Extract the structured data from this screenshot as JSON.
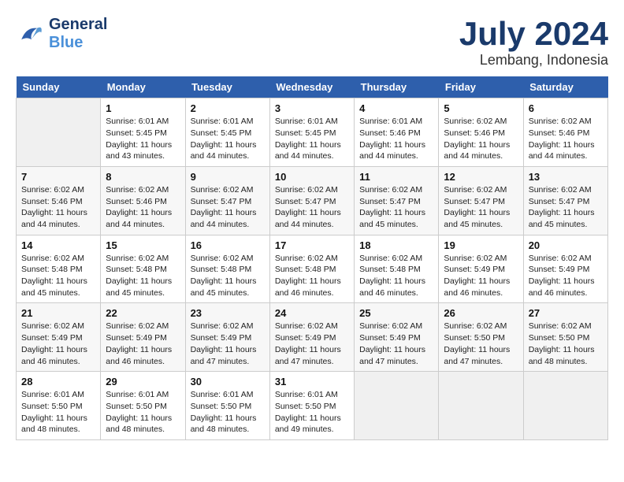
{
  "logo": {
    "line1": "General",
    "line2": "Blue"
  },
  "title": "July 2024",
  "location": "Lembang, Indonesia",
  "days_of_week": [
    "Sunday",
    "Monday",
    "Tuesday",
    "Wednesday",
    "Thursday",
    "Friday",
    "Saturday"
  ],
  "weeks": [
    [
      {
        "day": "",
        "sunrise": "",
        "sunset": "",
        "daylight": "",
        "minutes": ""
      },
      {
        "day": "1",
        "sunrise": "Sunrise: 6:01 AM",
        "sunset": "Sunset: 5:45 PM",
        "daylight": "Daylight: 11 hours",
        "minutes": "and 43 minutes."
      },
      {
        "day": "2",
        "sunrise": "Sunrise: 6:01 AM",
        "sunset": "Sunset: 5:45 PM",
        "daylight": "Daylight: 11 hours",
        "minutes": "and 44 minutes."
      },
      {
        "day": "3",
        "sunrise": "Sunrise: 6:01 AM",
        "sunset": "Sunset: 5:45 PM",
        "daylight": "Daylight: 11 hours",
        "minutes": "and 44 minutes."
      },
      {
        "day": "4",
        "sunrise": "Sunrise: 6:01 AM",
        "sunset": "Sunset: 5:46 PM",
        "daylight": "Daylight: 11 hours",
        "minutes": "and 44 minutes."
      },
      {
        "day": "5",
        "sunrise": "Sunrise: 6:02 AM",
        "sunset": "Sunset: 5:46 PM",
        "daylight": "Daylight: 11 hours",
        "minutes": "and 44 minutes."
      },
      {
        "day": "6",
        "sunrise": "Sunrise: 6:02 AM",
        "sunset": "Sunset: 5:46 PM",
        "daylight": "Daylight: 11 hours",
        "minutes": "and 44 minutes."
      }
    ],
    [
      {
        "day": "7",
        "sunrise": "Sunrise: 6:02 AM",
        "sunset": "Sunset: 5:46 PM",
        "daylight": "Daylight: 11 hours",
        "minutes": "and 44 minutes."
      },
      {
        "day": "8",
        "sunrise": "Sunrise: 6:02 AM",
        "sunset": "Sunset: 5:46 PM",
        "daylight": "Daylight: 11 hours",
        "minutes": "and 44 minutes."
      },
      {
        "day": "9",
        "sunrise": "Sunrise: 6:02 AM",
        "sunset": "Sunset: 5:47 PM",
        "daylight": "Daylight: 11 hours",
        "minutes": "and 44 minutes."
      },
      {
        "day": "10",
        "sunrise": "Sunrise: 6:02 AM",
        "sunset": "Sunset: 5:47 PM",
        "daylight": "Daylight: 11 hours",
        "minutes": "and 44 minutes."
      },
      {
        "day": "11",
        "sunrise": "Sunrise: 6:02 AM",
        "sunset": "Sunset: 5:47 PM",
        "daylight": "Daylight: 11 hours",
        "minutes": "and 45 minutes."
      },
      {
        "day": "12",
        "sunrise": "Sunrise: 6:02 AM",
        "sunset": "Sunset: 5:47 PM",
        "daylight": "Daylight: 11 hours",
        "minutes": "and 45 minutes."
      },
      {
        "day": "13",
        "sunrise": "Sunrise: 6:02 AM",
        "sunset": "Sunset: 5:47 PM",
        "daylight": "Daylight: 11 hours",
        "minutes": "and 45 minutes."
      }
    ],
    [
      {
        "day": "14",
        "sunrise": "Sunrise: 6:02 AM",
        "sunset": "Sunset: 5:48 PM",
        "daylight": "Daylight: 11 hours",
        "minutes": "and 45 minutes."
      },
      {
        "day": "15",
        "sunrise": "Sunrise: 6:02 AM",
        "sunset": "Sunset: 5:48 PM",
        "daylight": "Daylight: 11 hours",
        "minutes": "and 45 minutes."
      },
      {
        "day": "16",
        "sunrise": "Sunrise: 6:02 AM",
        "sunset": "Sunset: 5:48 PM",
        "daylight": "Daylight: 11 hours",
        "minutes": "and 45 minutes."
      },
      {
        "day": "17",
        "sunrise": "Sunrise: 6:02 AM",
        "sunset": "Sunset: 5:48 PM",
        "daylight": "Daylight: 11 hours",
        "minutes": "and 46 minutes."
      },
      {
        "day": "18",
        "sunrise": "Sunrise: 6:02 AM",
        "sunset": "Sunset: 5:48 PM",
        "daylight": "Daylight: 11 hours",
        "minutes": "and 46 minutes."
      },
      {
        "day": "19",
        "sunrise": "Sunrise: 6:02 AM",
        "sunset": "Sunset: 5:49 PM",
        "daylight": "Daylight: 11 hours",
        "minutes": "and 46 minutes."
      },
      {
        "day": "20",
        "sunrise": "Sunrise: 6:02 AM",
        "sunset": "Sunset: 5:49 PM",
        "daylight": "Daylight: 11 hours",
        "minutes": "and 46 minutes."
      }
    ],
    [
      {
        "day": "21",
        "sunrise": "Sunrise: 6:02 AM",
        "sunset": "Sunset: 5:49 PM",
        "daylight": "Daylight: 11 hours",
        "minutes": "and 46 minutes."
      },
      {
        "day": "22",
        "sunrise": "Sunrise: 6:02 AM",
        "sunset": "Sunset: 5:49 PM",
        "daylight": "Daylight: 11 hours",
        "minutes": "and 46 minutes."
      },
      {
        "day": "23",
        "sunrise": "Sunrise: 6:02 AM",
        "sunset": "Sunset: 5:49 PM",
        "daylight": "Daylight: 11 hours",
        "minutes": "and 47 minutes."
      },
      {
        "day": "24",
        "sunrise": "Sunrise: 6:02 AM",
        "sunset": "Sunset: 5:49 PM",
        "daylight": "Daylight: 11 hours",
        "minutes": "and 47 minutes."
      },
      {
        "day": "25",
        "sunrise": "Sunrise: 6:02 AM",
        "sunset": "Sunset: 5:49 PM",
        "daylight": "Daylight: 11 hours",
        "minutes": "and 47 minutes."
      },
      {
        "day": "26",
        "sunrise": "Sunrise: 6:02 AM",
        "sunset": "Sunset: 5:50 PM",
        "daylight": "Daylight: 11 hours",
        "minutes": "and 47 minutes."
      },
      {
        "day": "27",
        "sunrise": "Sunrise: 6:02 AM",
        "sunset": "Sunset: 5:50 PM",
        "daylight": "Daylight: 11 hours",
        "minutes": "and 48 minutes."
      }
    ],
    [
      {
        "day": "28",
        "sunrise": "Sunrise: 6:01 AM",
        "sunset": "Sunset: 5:50 PM",
        "daylight": "Daylight: 11 hours",
        "minutes": "and 48 minutes."
      },
      {
        "day": "29",
        "sunrise": "Sunrise: 6:01 AM",
        "sunset": "Sunset: 5:50 PM",
        "daylight": "Daylight: 11 hours",
        "minutes": "and 48 minutes."
      },
      {
        "day": "30",
        "sunrise": "Sunrise: 6:01 AM",
        "sunset": "Sunset: 5:50 PM",
        "daylight": "Daylight: 11 hours",
        "minutes": "and 48 minutes."
      },
      {
        "day": "31",
        "sunrise": "Sunrise: 6:01 AM",
        "sunset": "Sunset: 5:50 PM",
        "daylight": "Daylight: 11 hours",
        "minutes": "and 49 minutes."
      },
      {
        "day": "",
        "sunrise": "",
        "sunset": "",
        "daylight": "",
        "minutes": ""
      },
      {
        "day": "",
        "sunrise": "",
        "sunset": "",
        "daylight": "",
        "minutes": ""
      },
      {
        "day": "",
        "sunrise": "",
        "sunset": "",
        "daylight": "",
        "minutes": ""
      }
    ]
  ]
}
